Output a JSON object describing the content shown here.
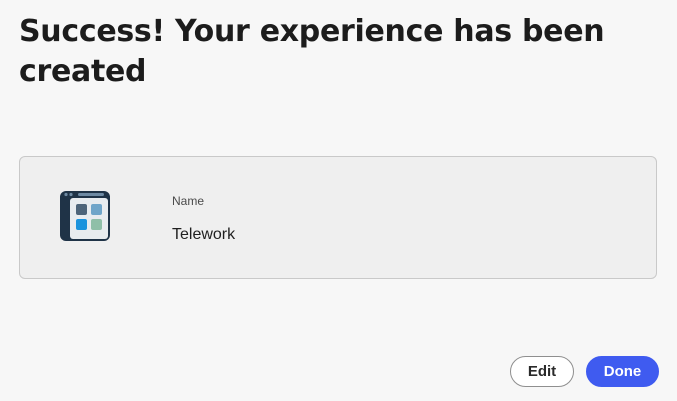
{
  "dialog": {
    "title": "Success! Your experience has been created"
  },
  "experience": {
    "icon": "grid-layout-app-icon",
    "name_label": "Name",
    "name_value": "Telework"
  },
  "actions": {
    "edit_label": "Edit",
    "done_label": "Done"
  },
  "colors": {
    "primary": "#3f5bf0",
    "background": "#f7f7f7",
    "card_background": "#efefef"
  }
}
